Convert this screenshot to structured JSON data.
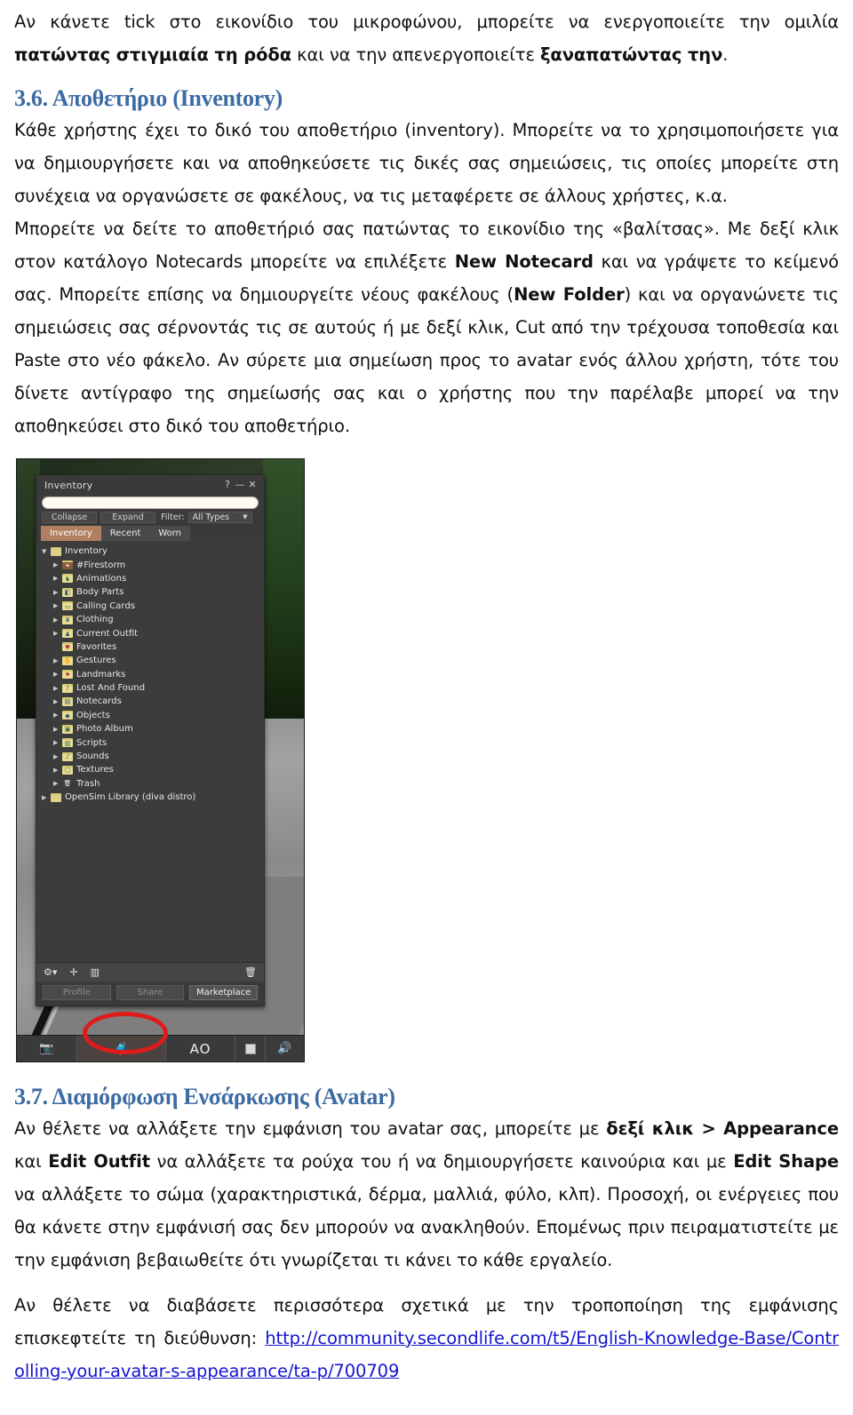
{
  "document": {
    "intro_paragraph": {
      "run1": "Αν κάνετε tick στο εικονίδιο του μικροφώνου, μπορείτε να ενεργοποιείτε την ομιλία ",
      "run2_bold": "πατώντας στιγμιαία τη ρόδα",
      "run3": " και να την απενεργοποιείτε ",
      "run4_bold": "ξαναπατώντας την",
      "run5": "."
    },
    "section_36": {
      "heading": "3.6. Αποθετήριο (Inventory)",
      "p1": "Κάθε χρήστης έχει το δικό του αποθετήριο (inventory). Μπορείτε να το χρησιμοποιήσετε για να δημιουργήσετε και να αποθηκεύσετε τις δικές σας σημειώσεις, τις οποίες μπορείτε στη συνέχεια να οργανώσετε σε φακέλους, να τις μεταφέρετε σε άλλους χρήστες, κ.α.",
      "p2_run1": "Μπορείτε να δείτε το αποθετήριό σας πατώντας το εικονίδιο της «βαλίτσας». Με δεξί κλικ στον κατάλογο Notecards μπορείτε να επιλέξετε ",
      "p2_run2_bold": "New Notecard",
      "p2_run3": " και να γράψετε το κείμενό σας. Μπορείτε επίσης να δημιουργείτε νέους φακέλους (",
      "p2_run4_bold": "New Folder",
      "p2_run5": ") και να οργανώνετε τις σημειώσεις σας σέρνοντάς τις σε αυτούς ή με δεξί κλικ, Cut από την τρέχουσα τοποθεσία και Paste στο νέο φάκελο. Αν σύρετε μια σημείωση προς το avatar ενός άλλου χρήστη, τότε του δίνετε αντίγραφο της σημείωσής σας και ο χρήστης που την παρέλαβε μπορεί να την αποθηκεύσει στο δικό του αποθετήριο."
    },
    "section_37": {
      "heading": "3.7. Διαμόρφωση Ενσάρκωσης (Avatar)",
      "p1_run1": "Αν θέλετε να αλλάξετε την εμφάνιση του avatar σας, μπορείτε με ",
      "p1_run2_bold": "δεξί κλικ > Appearance",
      "p1_run3": " και ",
      "p1_run4_bold": "Edit Outfit",
      "p1_run5": " να αλλάξετε τα ρούχα του ή να δημιουργήσετε καινούρια και με ",
      "p1_run6_bold": "Edit Shape",
      "p1_run7": " να αλλάξετε το σώμα (χαρακτηριστικά, δέρμα, μαλλιά, φύλο, κλπ). Προσοχή, οι ενέργειες που θα κάνετε στην εμφάνισή σας δεν μπορούν να ανακληθούν. Επομένως πριν πειραματιστείτε με την εμφάνιση βεβαιωθείτε ότι γνωρίζεται τι κάνει το κάθε εργαλείο.",
      "p2_run1": "Αν θέλετε να διαβάσετε περισσότερα σχετικά με την τροποποίηση της εμφάνισης επισκεφτείτε τη διεύθυνση: ",
      "p2_link": "http://community.secondlife.com/t5/English-Knowledge-Base/Controlling-your-avatar-s-appearance/ta-p/700709"
    }
  },
  "figure": {
    "caption_alt": "Firestorm viewer Inventory window screenshot",
    "window": {
      "title": "Inventory",
      "titlebar_buttons": [
        "?",
        "—",
        "✕"
      ],
      "search_value": "",
      "search_placeholder": "",
      "buttons": {
        "collapse": "Collapse",
        "expand": "Expand",
        "filter_label": "Filter:",
        "filter_value": "All Types"
      },
      "tabs": [
        {
          "label": "Inventory",
          "active": true
        },
        {
          "label": "Recent",
          "active": false
        },
        {
          "label": "Worn",
          "active": false
        }
      ],
      "tree": [
        {
          "label": "Inventory",
          "level": 0,
          "expanded": true,
          "has_arrow": true,
          "icon": "folder-icon",
          "icon_glyph": "",
          "icon_class": "plain"
        },
        {
          "label": "#Firestorm",
          "level": 1,
          "expanded": false,
          "has_arrow": true,
          "icon": "folder-firestorm-icon",
          "icon_glyph": "✦",
          "icon_class": "brown"
        },
        {
          "label": "Animations",
          "level": 1,
          "expanded": false,
          "has_arrow": true,
          "icon": "folder-animations-icon",
          "icon_glyph": "♞",
          "icon_class": "green"
        },
        {
          "label": "Body Parts",
          "level": 1,
          "expanded": false,
          "has_arrow": true,
          "icon": "folder-bodyparts-icon",
          "icon_glyph": "◧",
          "icon_class": "blue"
        },
        {
          "label": "Calling Cards",
          "level": 1,
          "expanded": false,
          "has_arrow": true,
          "icon": "folder-callingcards-icon",
          "icon_glyph": "▭",
          "icon_class": "green"
        },
        {
          "label": "Clothing",
          "level": 1,
          "expanded": false,
          "has_arrow": true,
          "icon": "folder-clothing-icon",
          "icon_glyph": "♛",
          "icon_class": "blue"
        },
        {
          "label": "Current Outfit",
          "level": 1,
          "expanded": false,
          "has_arrow": true,
          "icon": "folder-currentoutfit-icon",
          "icon_glyph": "♟",
          "icon_class": "blue"
        },
        {
          "label": "Favorites",
          "level": 1,
          "expanded": false,
          "has_arrow": false,
          "icon": "folder-favorites-icon",
          "icon_glyph": "♥",
          "icon_class": "pink"
        },
        {
          "label": "Gestures",
          "level": 1,
          "expanded": false,
          "has_arrow": true,
          "icon": "folder-gestures-icon",
          "icon_glyph": "✋",
          "icon_class": "green"
        },
        {
          "label": "Landmarks",
          "level": 1,
          "expanded": false,
          "has_arrow": true,
          "icon": "folder-landmarks-icon",
          "icon_glyph": "⚑",
          "icon_class": "red"
        },
        {
          "label": "Lost And Found",
          "level": 1,
          "expanded": false,
          "has_arrow": true,
          "icon": "folder-lostandfound-icon",
          "icon_glyph": "?",
          "icon_class": "blue"
        },
        {
          "label": "Notecards",
          "level": 1,
          "expanded": false,
          "has_arrow": true,
          "icon": "folder-notecards-icon",
          "icon_glyph": "▤",
          "icon_class": "blue"
        },
        {
          "label": "Objects",
          "level": 1,
          "expanded": false,
          "has_arrow": true,
          "icon": "folder-objects-icon",
          "icon_glyph": "◆",
          "icon_class": "blue"
        },
        {
          "label": "Photo Album",
          "level": 1,
          "expanded": false,
          "has_arrow": true,
          "icon": "folder-photoalbum-icon",
          "icon_glyph": "▣",
          "icon_class": "green"
        },
        {
          "label": "Scripts",
          "level": 1,
          "expanded": false,
          "has_arrow": true,
          "icon": "folder-scripts-icon",
          "icon_glyph": "▥",
          "icon_class": "green"
        },
        {
          "label": "Sounds",
          "level": 1,
          "expanded": false,
          "has_arrow": true,
          "icon": "folder-sounds-icon",
          "icon_glyph": "♪",
          "icon_class": "green"
        },
        {
          "label": "Textures",
          "level": 1,
          "expanded": false,
          "has_arrow": true,
          "icon": "folder-textures-icon",
          "icon_glyph": "▢",
          "icon_class": "green"
        },
        {
          "label": "Trash",
          "level": 1,
          "expanded": false,
          "has_arrow": true,
          "icon": "trash-icon",
          "icon_glyph": "🗑",
          "icon_class": "trash"
        },
        {
          "label": "OpenSim Library (diva distro)",
          "level": 0,
          "expanded": false,
          "has_arrow": true,
          "icon": "folder-icon",
          "icon_glyph": "",
          "icon_class": "plain"
        }
      ],
      "toolbar_icons": [
        {
          "name": "gear-menu-icon",
          "glyph": "⚙▾"
        },
        {
          "name": "add-icon",
          "glyph": "✛"
        },
        {
          "name": "gallery-view-icon",
          "glyph": "▥"
        },
        {
          "name": "trash-icon",
          "glyph": "🗑"
        }
      ],
      "footer_buttons": [
        {
          "label": "Profile",
          "enabled": false
        },
        {
          "label": "Share",
          "enabled": false
        },
        {
          "label": "Marketplace",
          "enabled": true
        }
      ]
    },
    "sl_toolbar": [
      {
        "name": "camera-icon",
        "glyph": "📷",
        "label": ""
      },
      {
        "name": "inventory-icon",
        "glyph": "🧳",
        "label": "",
        "highlighted": true
      },
      {
        "name": "ao-button",
        "glyph": "",
        "label": "AO"
      },
      {
        "name": "square-icon",
        "glyph": "",
        "label": ""
      },
      {
        "name": "voice-icon",
        "glyph": "🔊",
        "label": ""
      }
    ],
    "annotation": {
      "shape": "red-ellipse",
      "color": "#e01b1b",
      "target": "inventory-icon"
    }
  }
}
